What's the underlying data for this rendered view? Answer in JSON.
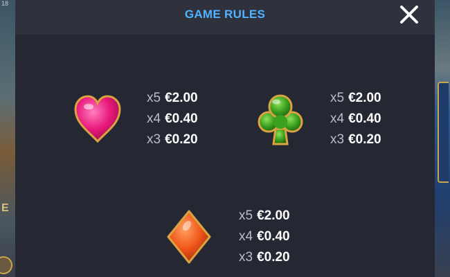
{
  "title": "GAME RULES",
  "close_icon": "close-icon",
  "background": {
    "left_number": "18",
    "left_letter": "E"
  },
  "paytables": [
    {
      "symbol": "heart-icon",
      "color": "#e8197a",
      "payouts": [
        {
          "multiplier": "x5",
          "value": "€2.00"
        },
        {
          "multiplier": "x4",
          "value": "€0.40"
        },
        {
          "multiplier": "x3",
          "value": "€0.20"
        }
      ]
    },
    {
      "symbol": "club-icon",
      "color": "#3aa11e",
      "payouts": [
        {
          "multiplier": "x5",
          "value": "€2.00"
        },
        {
          "multiplier": "x4",
          "value": "€0.40"
        },
        {
          "multiplier": "x3",
          "value": "€0.20"
        }
      ]
    },
    {
      "symbol": "diamond-icon",
      "color": "#f0561a",
      "payouts": [
        {
          "multiplier": "x5",
          "value": "€2.00"
        },
        {
          "multiplier": "x4",
          "value": "€0.40"
        },
        {
          "multiplier": "x3",
          "value": "€0.20"
        }
      ]
    }
  ]
}
